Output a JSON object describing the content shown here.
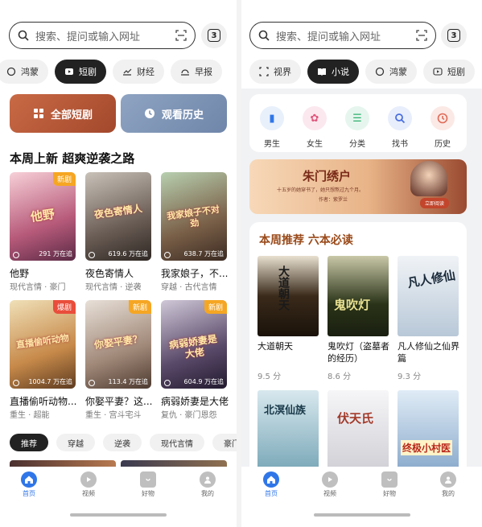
{
  "left": {
    "search_placeholder": "搜索、提问或输入网址",
    "tab_count": "3",
    "chips": [
      {
        "label": "鸿蒙",
        "icon": "circle-icon"
      },
      {
        "label": "短剧",
        "icon": "play-box-icon",
        "active": true
      },
      {
        "label": "财经",
        "icon": "chart-icon"
      },
      {
        "label": "早报",
        "icon": "sunrise-icon"
      }
    ],
    "all_dramas_label": "全部短剧",
    "history_label": "观看历史",
    "section_title": "本周上新 超爽逆袭之路",
    "dramas": [
      {
        "title": "他野",
        "tags": "现代言情 · 豪门",
        "count": "291 万在追",
        "badge": "新剧",
        "poster_text": "他野"
      },
      {
        "title": "夜色寄情人",
        "tags": "现代言情 · 逆袭",
        "count": "619.6 万在追",
        "badge": "",
        "poster_text": "夜色寄情人"
      },
      {
        "title": "我家娘子，不...",
        "tags": "穿越 · 古代言情",
        "count": "638.7 万在追",
        "badge": "",
        "poster_text": "我家娘子不对劲"
      },
      {
        "title": "直播偷听动物...",
        "tags": "重生 · 超能",
        "count": "1004.7 万在追",
        "badge": "爆剧",
        "poster_text": "直播偷听动物"
      },
      {
        "title": "你娶平妻？这...",
        "tags": "重生 · 宫斗宅斗",
        "count": "113.4 万在追",
        "badge": "新剧",
        "poster_text": "你娶平妻？"
      },
      {
        "title": "病弱娇妻是大佬",
        "tags": "复仇 · 豪门恩怨",
        "count": "604.9 万在追",
        "badge": "新剧",
        "poster_text": "病弱娇妻是大佬"
      }
    ],
    "filters": [
      {
        "label": "推荐",
        "active": true
      },
      {
        "label": "穿越"
      },
      {
        "label": "逆袭"
      },
      {
        "label": "现代言情"
      },
      {
        "label": "豪门恩怨"
      }
    ],
    "nav": [
      {
        "label": "首页",
        "icon": "home-icon",
        "active": true
      },
      {
        "label": "视频",
        "icon": "video-icon"
      },
      {
        "label": "好物",
        "icon": "shopping-bag-icon"
      },
      {
        "label": "我的",
        "icon": "user-icon"
      }
    ]
  },
  "right": {
    "search_placeholder": "搜索、提问或输入网址",
    "tab_count": "3",
    "chips": [
      {
        "label": "视界",
        "icon": "frame-icon"
      },
      {
        "label": "小说",
        "icon": "book-icon",
        "active": true
      },
      {
        "label": "鸿蒙",
        "icon": "circle-icon"
      },
      {
        "label": "短剧",
        "icon": "play-box-icon"
      }
    ],
    "categories": [
      {
        "label": "男生",
        "icon": "male-book-icon",
        "color": "#e8f0fb",
        "fg": "#2f76e8"
      },
      {
        "label": "女生",
        "icon": "flower-icon",
        "color": "#fbe8ee",
        "fg": "#e0567c"
      },
      {
        "label": "分类",
        "icon": "list-icon",
        "color": "#e6f6ee",
        "fg": "#2fb06e"
      },
      {
        "label": "找书",
        "icon": "search-icon",
        "color": "#e8eefb",
        "fg": "#4a6ee0"
      },
      {
        "label": "历史",
        "icon": "clock-icon",
        "color": "#fbe9e6",
        "fg": "#e06a56"
      }
    ],
    "banner": {
      "title": "朱门绣户",
      "desc": "十五岁的她穿书了，她只想熬过九个月。",
      "author": "作者：紫罗兰",
      "button": "立即阅读"
    },
    "section_title": "本周推荐 六本必读",
    "books": [
      {
        "title": "大道朝天",
        "score": "9.5 分",
        "cover_text": "大道朝天",
        "cover_bg": "#3a2a1a"
      },
      {
        "title": "鬼吹灯（盗墓者的经历）",
        "score": "8.6 分",
        "cover_text": "鬼吹灯",
        "cover_bg": "#2a3318"
      },
      {
        "title": "凡人修仙之仙界篇",
        "score": "9.3 分",
        "cover_text": "凡人修仙",
        "cover_bg": "#dce6ef"
      },
      {
        "title": "北冥仙族",
        "score": "",
        "cover_text": "北溟仙族",
        "cover_bg": "#a7c8d4"
      },
      {
        "title": "伏天氏",
        "score": "",
        "cover_text": "伏天氏",
        "cover_bg": "#e8e8ea"
      },
      {
        "title": "终极小村医",
        "score": "",
        "cover_text": "终极小村医",
        "cover_bg": "#bcd3e8"
      }
    ],
    "nav": [
      {
        "label": "首页",
        "icon": "home-icon",
        "active": true
      },
      {
        "label": "视频",
        "icon": "video-icon"
      },
      {
        "label": "好物",
        "icon": "shopping-bag-icon"
      },
      {
        "label": "我的",
        "icon": "user-icon"
      }
    ]
  }
}
